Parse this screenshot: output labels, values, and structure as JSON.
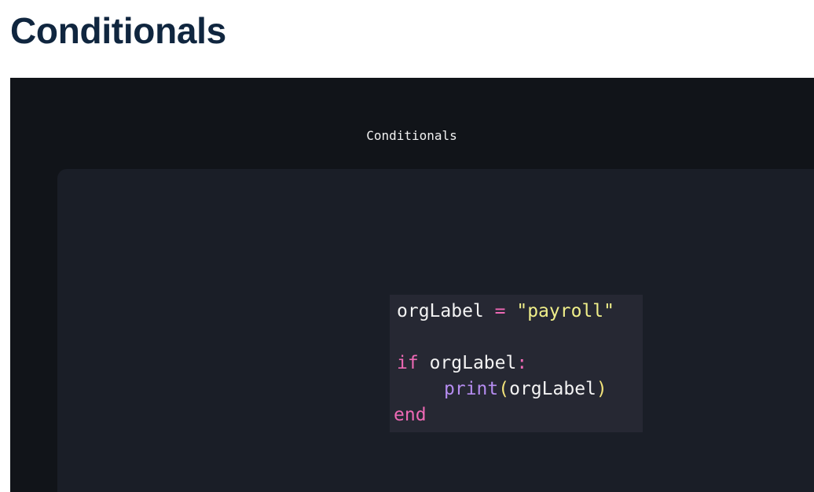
{
  "page": {
    "heading": "Conditionals"
  },
  "video": {
    "slide_title": "Conditionals",
    "code": {
      "line1": {
        "identifier": "orgLabel",
        "operator": "=",
        "string": "\"payroll\""
      },
      "line3": {
        "keyword": "if",
        "identifier": "orgLabel",
        "colon": ":"
      },
      "line4": {
        "function": "print",
        "open_paren": "(",
        "argument": "orgLabel",
        "close_paren": ")"
      },
      "line5": {
        "keyword": "end"
      }
    }
  },
  "colors": {
    "heading": "#10263f",
    "video_background": "#111419",
    "panel_background": "#1a1e27",
    "code_background": "#262833",
    "keyword": "#ee69b5",
    "string": "#f0ef8a",
    "function": "#b58cf0"
  }
}
